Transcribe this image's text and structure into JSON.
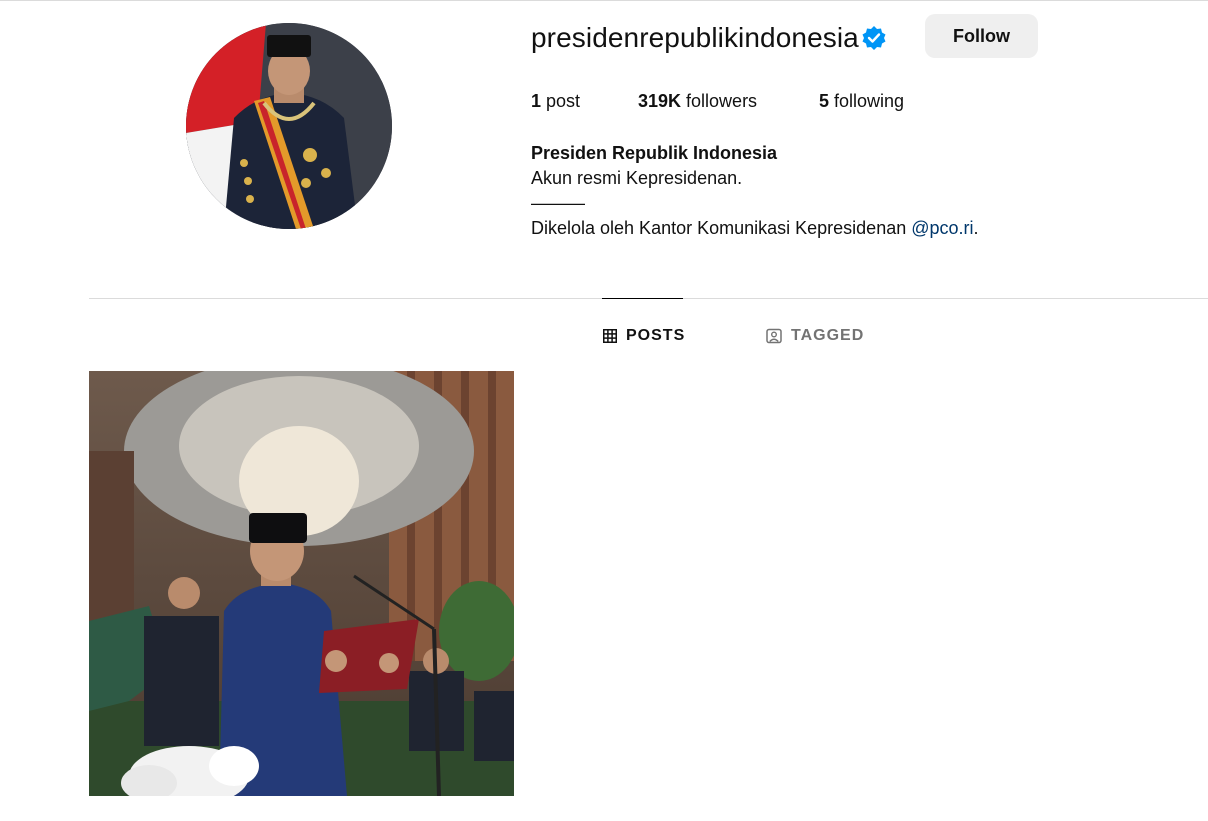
{
  "profile": {
    "username": "presidenrepublikindonesia",
    "follow_label": "Follow",
    "verified_icon": "verified-badge-icon"
  },
  "stats": {
    "posts_count": "1",
    "posts_label": " post",
    "followers_count": "319K",
    "followers_label": " followers",
    "following_count": "5",
    "following_label": " following"
  },
  "bio": {
    "name": "Presiden Republik Indonesia",
    "line1": "Akun resmi Kepresidenan.",
    "separator": "———",
    "line3_prefix": "Dikelola oleh Kantor Komunikasi Kepresidenan ",
    "link": "@pco.ri",
    "line3_suffix": "."
  },
  "tabs": {
    "posts": "POSTS",
    "tagged": "TAGGED"
  },
  "colors": {
    "verified": "#0095f6",
    "link": "#00376b",
    "button_bg": "#efefef",
    "inactive_tab": "#737373"
  }
}
